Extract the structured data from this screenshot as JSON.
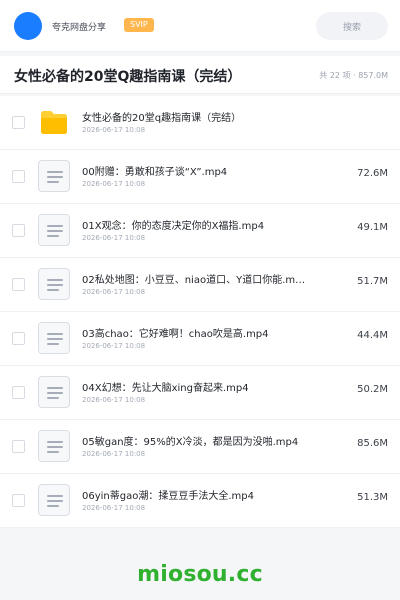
{
  "topbar": {
    "share_name": "夸克网盘分享",
    "svip_label": "SVIP",
    "search_label": "搜索",
    "avatar_color": "#1a7cff",
    "svip_color": "#ffb74d"
  },
  "header": {
    "title": "女性必备的20堂Q趣指南课（完结）",
    "meta": "共 22 项 · 857.0M"
  },
  "list": {
    "rows": [
      {
        "type": "folder",
        "name": "女性必备的20堂q趣指南课（完结）",
        "date": "2026-06-17 10:08",
        "size": ""
      },
      {
        "type": "doc",
        "name": "00附赠：勇敢和孩子谈“X”.mp4",
        "date": "2026-06-17 10:08",
        "size": "72.6M"
      },
      {
        "type": "doc",
        "name": "01X观念：你的态度决定你的X福指.mp4",
        "date": "2026-06-17 10:08",
        "size": "49.1M"
      },
      {
        "type": "doc",
        "name": "02私处地图：小豆豆、niao道口、Y道口你能.m…",
        "date": "2026-06-17 10:08",
        "size": "51.7M"
      },
      {
        "type": "doc",
        "name": "03高chao：它好难啊！chao吹是高.mp4",
        "date": "2026-06-17 10:08",
        "size": "44.4M"
      },
      {
        "type": "doc",
        "name": "04X幻想：先让大脑xing奋起来.mp4",
        "date": "2026-06-17 10:08",
        "size": "50.2M"
      },
      {
        "type": "doc",
        "name": "05敏gan度：95%的X冷淡，都是因为没啪.mp4",
        "date": "2026-06-17 10:08",
        "size": "85.6M"
      },
      {
        "type": "doc",
        "name": "06yin蒂gao潮：揉豆豆手法大全.mp4",
        "date": "2026-06-17 10:08",
        "size": "51.3M"
      }
    ]
  },
  "watermark": {
    "text": "miosou.cc",
    "color": "#2fb12f"
  }
}
